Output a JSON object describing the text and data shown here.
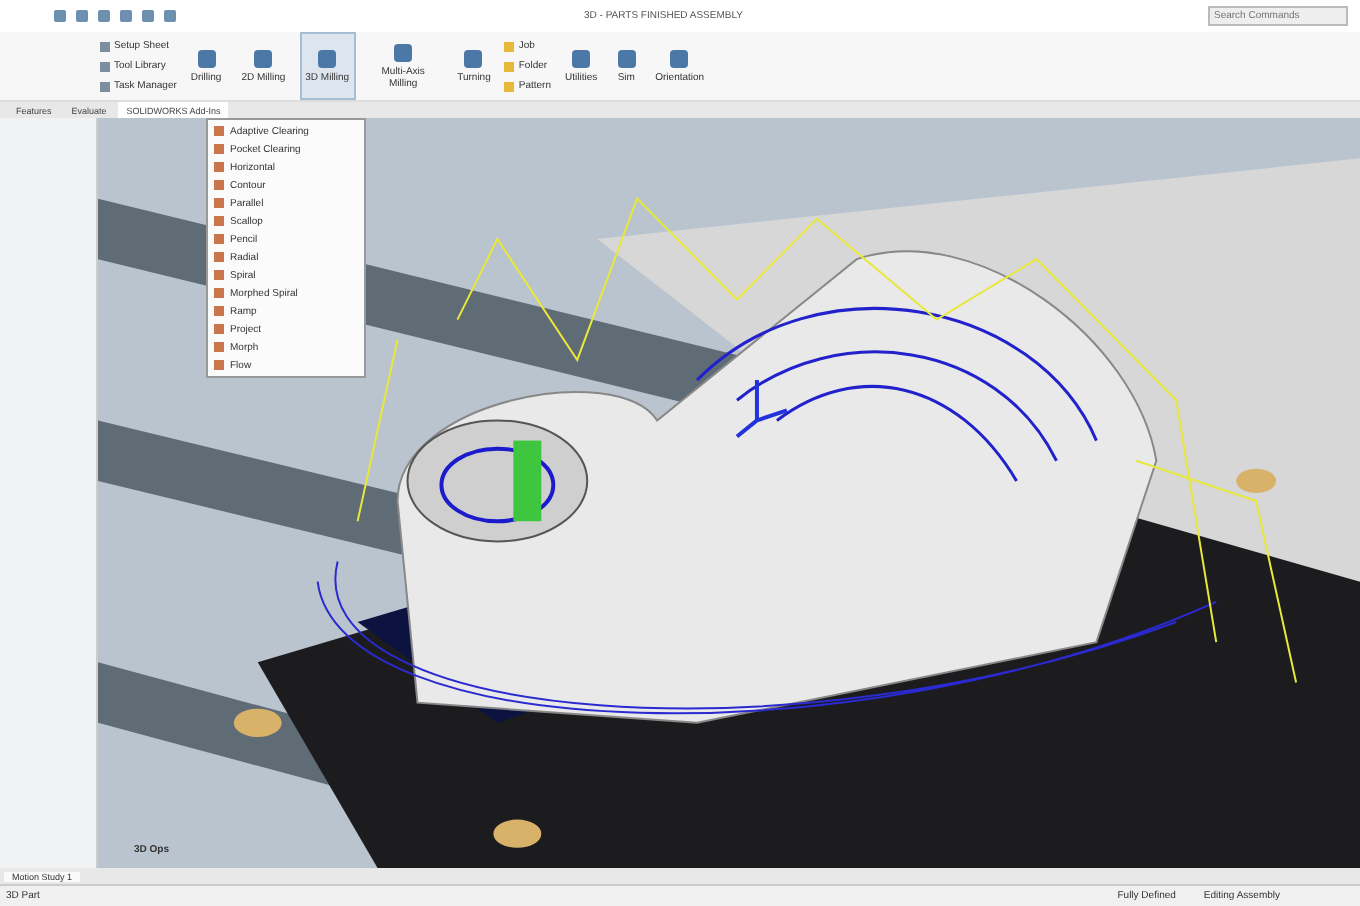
{
  "window": {
    "title": "3D - PARTS FINISHED ASSEMBLY",
    "search": {
      "placeholder": "Search Commands"
    }
  },
  "ribbon": {
    "left_items": [
      "Setup Sheet",
      "Tool Library",
      "Task Manager"
    ],
    "buttons": [
      {
        "label": "Drilling",
        "selected": false
      },
      {
        "label": "2D Milling",
        "selected": false
      },
      {
        "label": "3D Milling",
        "selected": true
      },
      {
        "label": "Multi-Axis Milling",
        "selected": false
      },
      {
        "label": "Turning",
        "selected": false
      }
    ],
    "small_items": [
      "Job",
      "Folder",
      "Pattern"
    ],
    "right_buttons": [
      "Utilities",
      "Sim",
      "Orientation"
    ]
  },
  "tabs": [
    {
      "label": "Features",
      "selected": false
    },
    {
      "label": "Evaluate",
      "selected": false
    },
    {
      "label": "SOLIDWORKS Add-Ins",
      "selected": true
    }
  ],
  "dropdown": {
    "items": [
      "Adaptive Clearing",
      "Pocket Clearing",
      "Horizontal",
      "Contour",
      "Parallel",
      "Scallop",
      "Pencil",
      "Radial",
      "Spiral",
      "Morphed Spiral",
      "Ramp",
      "Project",
      "Morph",
      "Flow"
    ]
  },
  "viewport": {
    "label": "3D Ops"
  },
  "bottom_tab": "Motion Study 1",
  "status_bar": {
    "left": "3D Part",
    "items": [
      "Fully Defined",
      "Editing Assembly"
    ]
  }
}
